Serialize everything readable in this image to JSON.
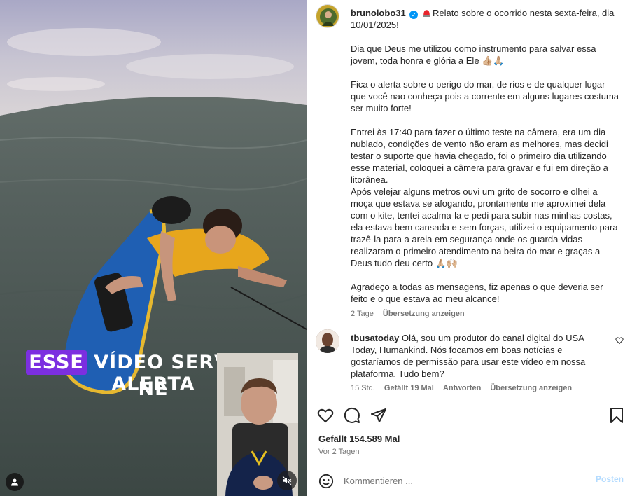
{
  "media": {
    "caption_highlight": "ESSE",
    "caption_rest": " VÍDEO SERVE DE ALERTA",
    "caption_line2": "NÉ",
    "icons": {
      "mute": "speaker-muted-icon",
      "tagged_user": "user-icon"
    }
  },
  "post": {
    "username": "brunolobo31",
    "headline": "Relato sobre o ocorrido nesta sexta-feira, dia 10/01/2025!",
    "paragraphs": [
      "Dia que Deus me utilizou como instrumento para salvar essa jovem, toda honra e glória a Ele 👍🏼🙏🏼",
      "Fica o alerta sobre o perigo do mar, de rios e de qualquer lugar que você nao conheça pois a corrente em alguns lugares costuma ser muito forte!",
      "Entrei às 17:40 para fazer o último teste na câmera, era um dia nublado, condições de vento não eram as melhores, mas decidi testar o suporte que havia chegado, foi o primeiro dia utilizando esse material, coloquei a câmera para gravar e fui em direção a litorânea.\nApós velejar alguns metros ouvi um grito de socorro e olhei a moça que estava se afogando, prontamente me aproximei dela com o kite, tentei acalma-la e pedi para subir nas minhas costas, ela estava bem cansada e sem forças, utilizei o equipamento para trazê-la para a areia em segurança onde os guarda-vidas realizaram o primeiro atendimento na beira do mar e graças a Deus tudo deu certo 🙏🏼🙌🏼",
      "Agradeço a todas as mensagens, fiz apenas o que deveria ser feito e o que estava ao meu alcance!"
    ],
    "time": "2 Tage",
    "translate": "Übersetzung anzeigen"
  },
  "comment": {
    "username": "tbusatoday",
    "text": "Olá, sou um produtor do canal digital do USA Today, Humankind. Nós focamos em boas notícias e gostaríamos de permissão para usar este vídeo em nossa plataforma. Tudo bem?",
    "time": "15 Std.",
    "likes": "Gefällt 19 Mal",
    "reply": "Antworten",
    "translate": "Übersetzung anzeigen"
  },
  "actions": {
    "likes": "Gefällt 154.589 Mal",
    "ago": "Vor 2 Tagen",
    "icons": [
      "heart-icon",
      "comment-icon",
      "share-icon",
      "bookmark-icon"
    ]
  },
  "composer": {
    "placeholder": "Kommentieren ...",
    "post_label": "Posten"
  },
  "colors": {
    "accent": "#0095f6",
    "caption_highlight": "#7c2fe0",
    "post_disabled": "#b3dbff"
  }
}
